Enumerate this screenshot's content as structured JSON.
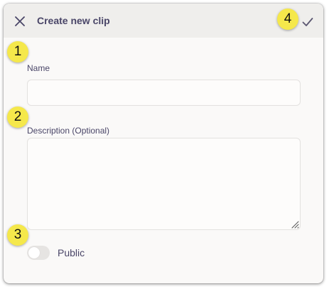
{
  "dialog": {
    "title": "Create new clip",
    "close_icon": "close-icon",
    "confirm_icon": "checkmark-icon"
  },
  "form": {
    "name": {
      "label": "Name",
      "value": "",
      "placeholder": ""
    },
    "description": {
      "label": "Description (Optional)",
      "value": "",
      "placeholder": ""
    },
    "public_toggle": {
      "label": "Public",
      "checked": false
    }
  },
  "callouts": [
    "1",
    "2",
    "3",
    "4"
  ],
  "colors": {
    "header_bg": "#efeeec",
    "dialog_bg": "#faf9f8",
    "text": "#4a4668",
    "callout": "#f5e84b"
  }
}
